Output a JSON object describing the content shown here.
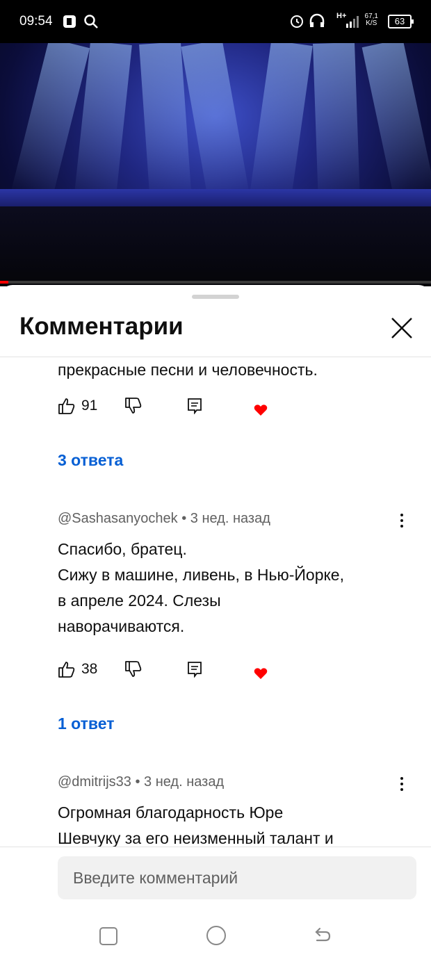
{
  "status_bar": {
    "time": "09:54",
    "network": "H+",
    "speed_value": "67,1",
    "speed_unit": "K/S",
    "battery": "63"
  },
  "video": {
    "progress_fraction": 0.02
  },
  "sheet": {
    "title": "Комментарии",
    "close_label": "close"
  },
  "comments": [
    {
      "text_lines": [
        "прекрасные песни и человечность."
      ],
      "likes": "91",
      "replies_label": "3 ответа"
    },
    {
      "author": "@Sashasanyochek",
      "time": "3 нед. назад",
      "text_lines": [
        "Спасибо, братец.",
        "Сижу в машине, ливень, в Нью-Йорке,",
        "в апреле 2024. Слезы",
        "наворачиваются."
      ],
      "likes": "38",
      "replies_label": "1 ответ"
    },
    {
      "author": "@dmitrijs33",
      "time": "3 нед. назад",
      "text_lines": [
        "Огромная благодарность Юре",
        "Шевчуку за его неизменный талант и"
      ]
    }
  ],
  "input": {
    "placeholder": "Введите комментарий"
  },
  "colors": {
    "link": "#065fd4",
    "heart": "#ff0000",
    "progress": "#ff0000"
  },
  "icons": [
    "like-icon",
    "dislike-icon",
    "reply-icon",
    "heart-icon",
    "more-icon",
    "close-icon"
  ]
}
